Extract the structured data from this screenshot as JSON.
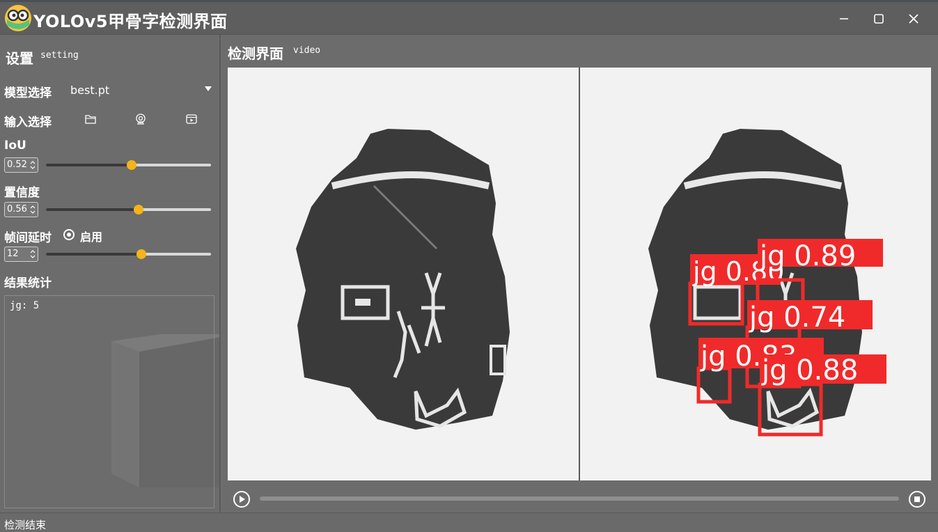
{
  "window": {
    "title": "YOLOv5甲骨字检测界面"
  },
  "settings": {
    "title": "设置",
    "subtitle": "setting",
    "model_label": "模型选择",
    "model_value": "best.pt",
    "input_label": "输入选择",
    "input_icons": [
      "folder-icon",
      "webcam-icon",
      "video-file-icon"
    ],
    "iou_label": "IoU",
    "iou_value": "0.52",
    "iou_level": 0.52,
    "conf_label": "置信度",
    "conf_value": "0.56",
    "conf_level": 0.56,
    "delay_label": "帧间延时",
    "delay_enable_label": "启用",
    "delay_value": "12",
    "delay_level": 0.58,
    "results_label": "结果统计",
    "results_text": "jg: 5"
  },
  "detection": {
    "title": "检测界面",
    "subtitle": "video",
    "progress": 0,
    "boxes": [
      {
        "label": "jg 0.89"
      },
      {
        "label": "jg 0.80"
      },
      {
        "label": "jg 0.74"
      },
      {
        "label": "jg 0.83"
      },
      {
        "label": "jg 0.88"
      }
    ]
  },
  "status": {
    "text": "检测结束"
  },
  "colors": {
    "accent": "#f4b41a",
    "detection_box": "#f02a2a"
  }
}
